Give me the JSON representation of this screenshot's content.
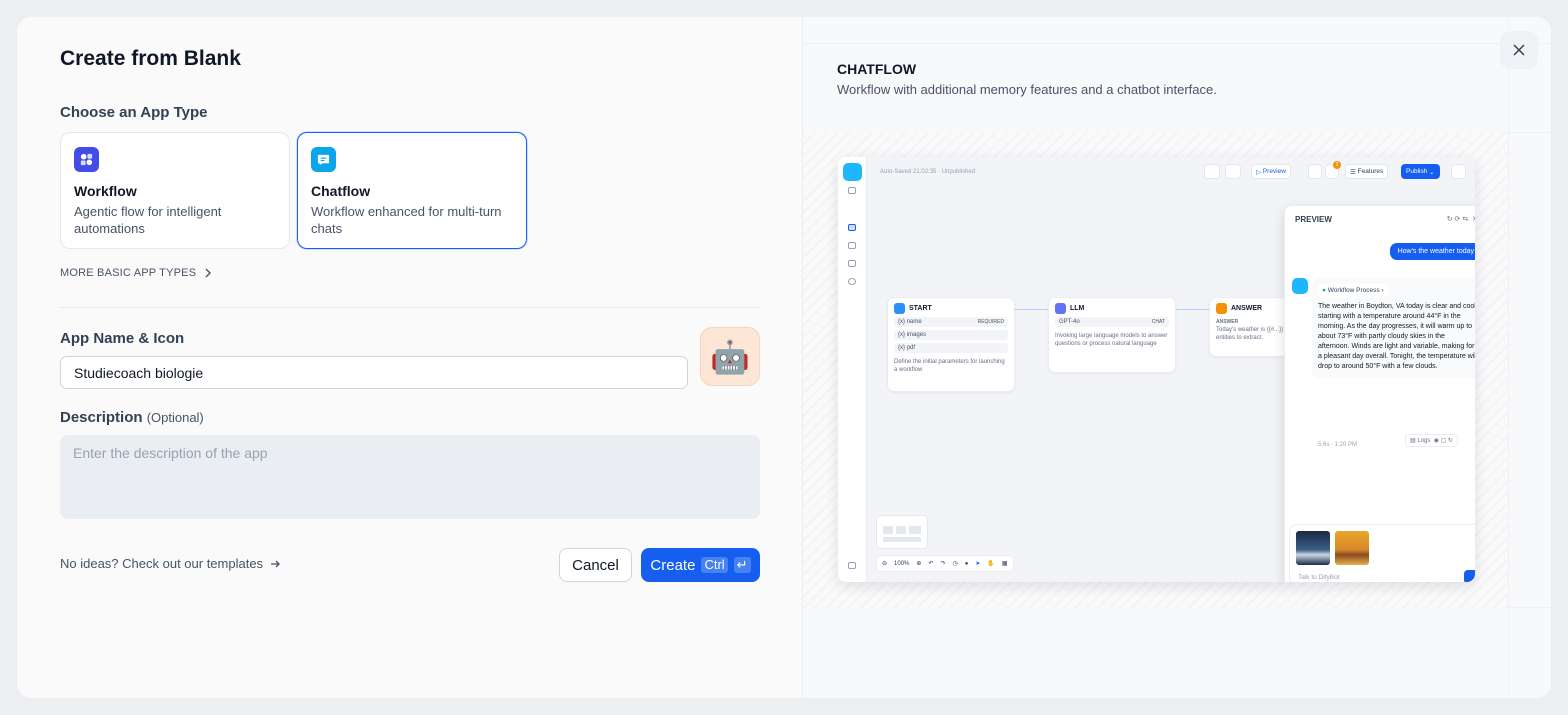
{
  "dialog": {
    "title": "Create from Blank",
    "app_type_label": "Choose an App Type",
    "app_types": [
      {
        "title": "Workflow",
        "description": "Agentic flow for intelligent automations",
        "selected": false,
        "icon": "workflow-icon",
        "color": "#444ce7"
      },
      {
        "title": "Chatflow",
        "description": "Workflow enhanced for multi-turn chats",
        "selected": true,
        "icon": "chatflow-icon",
        "color": "#0ba5ec"
      }
    ],
    "more_types_label": "MORE BASIC APP TYPES",
    "name_label": "App Name & Icon",
    "name_value": "Studiecoach biologie",
    "app_icon": "🤖",
    "description_label": "Description",
    "description_optional": "(Optional)",
    "description_placeholder": "Enter the description of the app",
    "templates_link": "No ideas? Check out our templates",
    "cancel_label": "Cancel",
    "create_label": "Create",
    "create_shortcut": "Ctrl",
    "create_shortcut_key": "↵"
  },
  "preview": {
    "type_title": "CHATFLOW",
    "type_description": "Workflow with additional memory features and a chatbot interface.",
    "autosave": "Auto-Saved 21:02:35 · Unpublished",
    "toolbar": {
      "preview": "Preview",
      "features": "Features",
      "publish": "Publish",
      "badge": "2"
    },
    "nodes": {
      "start": {
        "title": "START",
        "vars": [
          "name",
          "images",
          "pdf"
        ],
        "required": "REQUIRED",
        "text": "Define the initial parameters for launching a workflow"
      },
      "llm": {
        "title": "LLM",
        "model": "GPT-4o",
        "mode": "CHAT",
        "text": "Invoking large language models to answer questions or process natural language"
      },
      "answer": {
        "title": "ANSWER",
        "label": "ANSWER",
        "text": "Today's weather is {{#...}} entities to extract."
      }
    },
    "chat": {
      "header": "PREVIEW",
      "user_message": "How's the weather today",
      "process_label": "Workflow Process",
      "answer": "The weather in Boydton, VA today is clear and cool, starting with a temperature around 44°F in the morning. As the day progresses, it will warm up to about 73°F with partly cloudy skies in the afternoon. Winds are light and variable, making for a pleasant day overall. Tonight, the temperature will drop to around 50°F with a few clouds.",
      "meta": "5.6s · 1:20 PM",
      "logs": "Logs",
      "placeholder": "Talk to DifyBot"
    },
    "zoom": "100%"
  },
  "colors": {
    "accent": "#155eef",
    "workflow": "#444ce7",
    "chatflow": "#0ba5ec"
  }
}
